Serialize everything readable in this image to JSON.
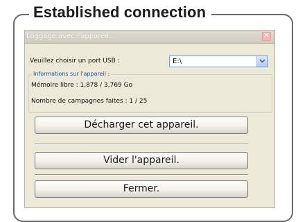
{
  "annotation": {
    "title": "Established connection"
  },
  "window": {
    "title": "Loggage avec l'appareil...",
    "close_symbol": "✕"
  },
  "usb": {
    "label": "Veuillez choisir un port USB :",
    "selected": "E:\\"
  },
  "device_info": {
    "legend": "Informations sur l'appareil :",
    "memory": "Mémoire libre : 1,878 / 3,769 Go",
    "campaigns": "Nombre de campagnes faites : 1 / 25"
  },
  "buttons": {
    "download": "Décharger cet appareil.",
    "empty": "Vider l'appareil.",
    "close": "Fermer."
  },
  "icons": {
    "close": "close-icon",
    "dropdown": "chevron-down-icon"
  },
  "colors": {
    "legend_text": "#1f4fb0",
    "dialog_background": "#ece9d8",
    "dropdown_accent": "#b5cbf1"
  }
}
